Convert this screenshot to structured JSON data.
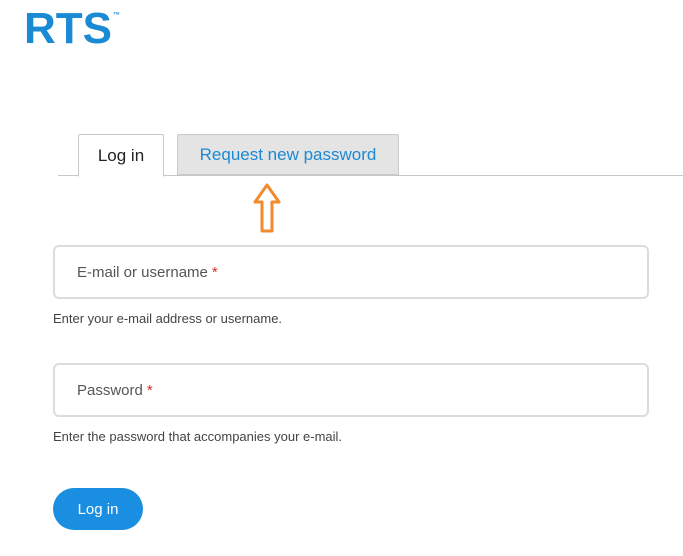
{
  "logo": {
    "text": "RTS",
    "trademark": "™",
    "color": "#1a8ad5"
  },
  "tabs": [
    {
      "label": "Log in",
      "active": true
    },
    {
      "label": "Request new password",
      "active": false
    }
  ],
  "annotation": {
    "icon": "up-arrow-icon",
    "color": "#f28a2e"
  },
  "form": {
    "email": {
      "placeholder": "E-mail or username",
      "required_marker": "*",
      "help": "Enter your e-mail address or username."
    },
    "password": {
      "placeholder": "Password",
      "required_marker": "*",
      "help": "Enter the password that accompanies your e-mail."
    },
    "submit_label": "Log in",
    "accent_color": "#1a8ee0",
    "required_color": "#d2302b"
  }
}
